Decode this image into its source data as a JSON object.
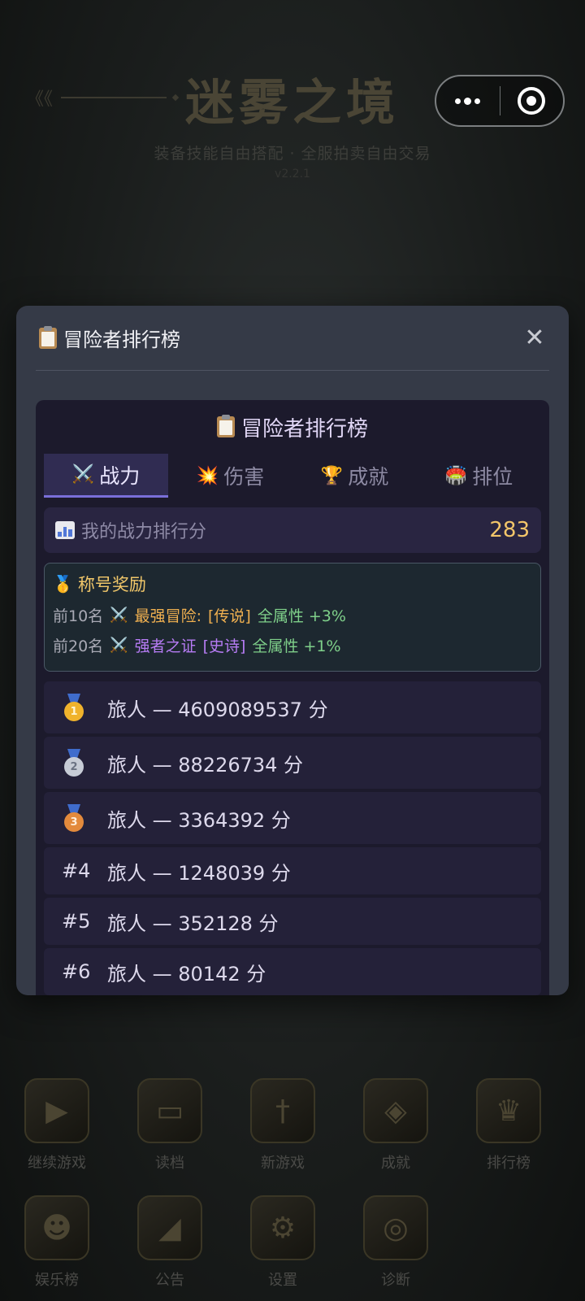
{
  "background": {
    "title": "迷雾之境",
    "deco": "《《",
    "subtitle": "装备技能自由搭配 · 全服拍卖自由交易",
    "version": "v2.2.1",
    "menu": [
      {
        "label": "继续游戏",
        "icon": "play-icon"
      },
      {
        "label": "读档",
        "icon": "scroll-icon"
      },
      {
        "label": "新游戏",
        "icon": "sword-icon"
      },
      {
        "label": "成就",
        "icon": "crest-icon"
      },
      {
        "label": "排行榜",
        "icon": "crown-icon"
      },
      {
        "label": "娱乐榜",
        "icon": "mask-icon"
      },
      {
        "label": "公告",
        "icon": "horn-icon"
      },
      {
        "label": "设置",
        "icon": "gear-icon"
      },
      {
        "label": "诊断",
        "icon": "fingerprint-icon"
      }
    ]
  },
  "capsule": {
    "more_icon": "more-dots-icon",
    "close_icon": "target-close-icon"
  },
  "modal": {
    "title": "冒险者排行榜",
    "close_label": "✕"
  },
  "board": {
    "title": "冒险者排行榜",
    "tabs": [
      {
        "label": "战力",
        "icon": "⚔️",
        "active": true
      },
      {
        "label": "伤害",
        "icon": "💥",
        "active": false
      },
      {
        "label": "成就",
        "icon": "🏆",
        "active": false
      },
      {
        "label": "排位",
        "icon": "🏟️",
        "active": false
      }
    ],
    "my_score": {
      "label": "我的战力排行分",
      "value": "283"
    },
    "reward": {
      "title": "称号奖励",
      "lines": [
        {
          "rank": "前10名",
          "name": "最强冒险:",
          "tier": "[传说]",
          "bonus": "全属性 +3%"
        },
        {
          "rank": "前20名",
          "name": "强者之证",
          "tier": "[史诗]",
          "bonus": "全属性 +1%"
        }
      ]
    },
    "rankings": [
      {
        "place": "1",
        "text": "旅人 — 4609089537 分"
      },
      {
        "place": "2",
        "text": "旅人 — 88226734 分"
      },
      {
        "place": "3",
        "text": "旅人 — 3364392 分"
      },
      {
        "place": "#4",
        "text": "旅人 — 1248039 分"
      },
      {
        "place": "#5",
        "text": "旅人 — 352128 分"
      },
      {
        "place": "#6",
        "text": "旅人 — 80142 分"
      }
    ]
  },
  "colors": {
    "accent": "#7a6fd9",
    "score": "#f3c66a",
    "legendary": "#f0b050",
    "epic": "#b77cf5",
    "bonus": "#7fd08a"
  }
}
